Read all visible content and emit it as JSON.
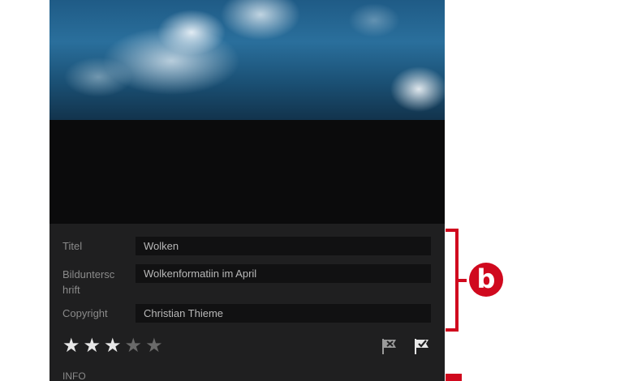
{
  "fields": {
    "title": {
      "label": "Titel",
      "value": "Wolken"
    },
    "caption": {
      "label_line1": "Bilduntersc",
      "label_line2": "hrift",
      "value": "Wolkenformatiin im April"
    },
    "copyright": {
      "label": "Copyright",
      "value": "Christian Thieme"
    }
  },
  "rating": {
    "value": 3,
    "max": 5
  },
  "flags": {
    "reject": "reject-flag-icon",
    "pick": "pick-flag-icon"
  },
  "info_label": "INFO",
  "annotation": {
    "badge_letter": "b",
    "color": "#d0091e"
  }
}
